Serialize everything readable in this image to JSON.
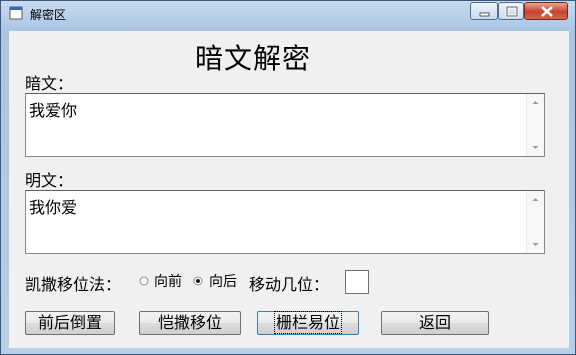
{
  "window": {
    "title": "解密区"
  },
  "heading": "暗文解密",
  "ciphertext": {
    "label": "暗文：",
    "value": "我爱你"
  },
  "plaintext": {
    "label": "明文：",
    "value": "我你爱"
  },
  "caesar": {
    "label": "凯撒移位法：",
    "options": [
      {
        "label": "向前",
        "selected": false
      },
      {
        "label": "向后",
        "selected": true
      }
    ],
    "shift_label": "移动几位：",
    "shift_value": ""
  },
  "buttons": {
    "reverse": "前后倒置",
    "caesar": "恺撒移位",
    "rail_fence": "栅栏易位",
    "back": "返回"
  }
}
